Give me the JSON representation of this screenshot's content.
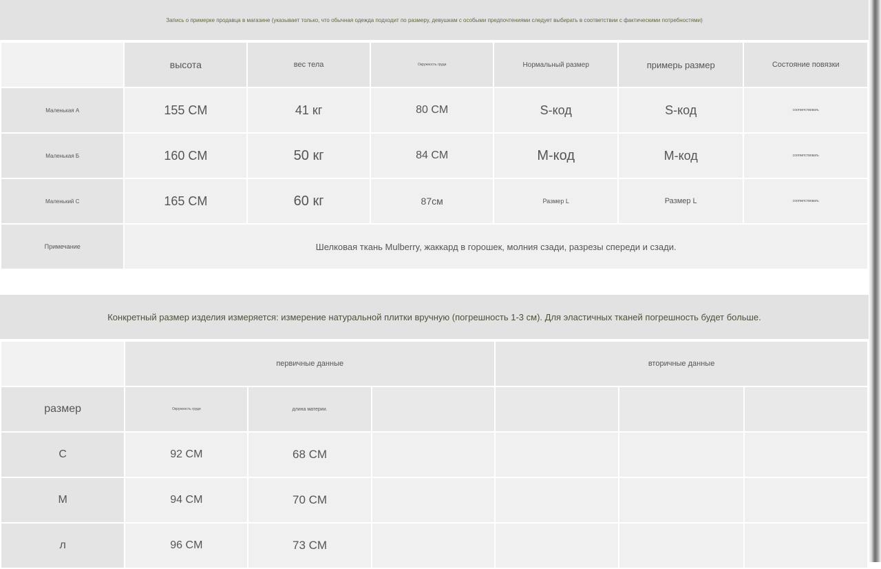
{
  "banner_top": "Запись о примерке продавца в магазине (указывает только, что обычная одежда подходит по размеру, девушкам с особыми предпочтениями следует выбирать в соответствии с фактическими потребностями)",
  "table1": {
    "headers": [
      "высота",
      "вес тела",
      "Окружность груди",
      "Нормальный размер",
      "примерь размер",
      "Состояние повязки"
    ],
    "rows": [
      {
        "label": "Маленькая A",
        "height": "155 CM",
        "weight": "41 кг",
        "bust": "80 CM",
        "normal": "S-код",
        "tryon": "S-код",
        "fit": "соответствовать"
      },
      {
        "label": "Маленькая Б",
        "height": "160 CM",
        "weight": "50 кг",
        "bust": "84 CM",
        "normal": "M-код",
        "tryon": "M-код",
        "fit": "соответствовать"
      },
      {
        "label": "Маленький С",
        "height": "165 CM",
        "weight": "60 кг",
        "bust": "87см",
        "normal": "Размер L",
        "tryon": "Размер L",
        "fit": "соответствовать"
      }
    ],
    "note_label": "Примечание",
    "note_text": "Шелковая ткань Mulberry, жаккард в горошек, молния сзади, разрезы спереди и сзади."
  },
  "banner_mid": "Конкретный размер изделия измеряется: измерение натуральной плитки вручную (погрешность 1-3 см). Для эластичных тканей погрешность будет больше.",
  "table2": {
    "group_primary": "первичные данные",
    "group_secondary": "вторичные данные",
    "size_header": "размер",
    "col_headers": [
      "Окружность груди",
      "длина материи."
    ],
    "rows": [
      {
        "size": "С",
        "bust": "92 CM",
        "length": "68 CM"
      },
      {
        "size": "М",
        "bust": "94 CM",
        "length": "70 CM"
      },
      {
        "size": "л",
        "bust": "96 CM",
        "length": "73 CM"
      }
    ]
  }
}
